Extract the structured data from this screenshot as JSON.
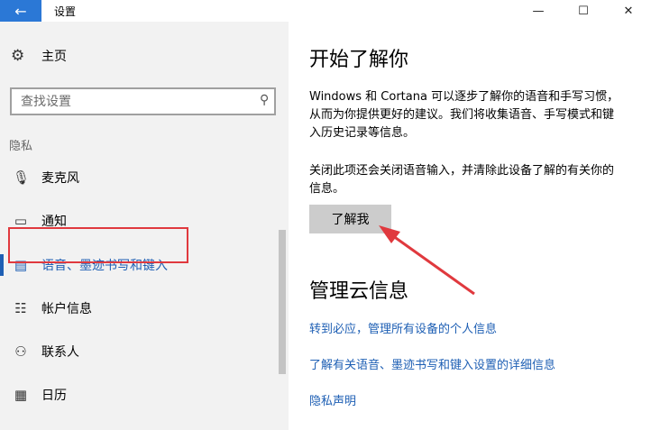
{
  "window": {
    "title": "设置",
    "back_icon": "←",
    "minimize_icon": "—",
    "maximize_icon": "☐",
    "close_icon": "✕"
  },
  "sidebar": {
    "home_label": "主页",
    "home_icon": "⚙",
    "search_placeholder": "查找设置",
    "search_icon": "⚲",
    "section_label": "隐私",
    "items": [
      {
        "label": "麦克风",
        "icon": "🎙"
      },
      {
        "label": "通知",
        "icon": "▭"
      },
      {
        "label": "语音、墨迹书写和键入",
        "icon": "▤",
        "active": true
      },
      {
        "label": "帐户信息",
        "icon": "☷"
      },
      {
        "label": "联系人",
        "icon": "⚇"
      },
      {
        "label": "日历",
        "icon": "▦"
      }
    ]
  },
  "main": {
    "heading": "开始了解你",
    "description": "Windows 和 Cortana 可以逐步了解你的语音和手写习惯，从而为你提供更好的建议。我们将收集语音、手写模式和键入历史记录等信息。",
    "note": "关闭此项还会关闭语音输入，并清除此设备了解的有关你的信息。",
    "button_label": "了解我",
    "cloud_heading": "管理云信息",
    "links": [
      "转到必应，管理所有设备的个人信息",
      "了解有关语音、墨迹书写和键入设置的详细信息",
      "隐私声明"
    ]
  },
  "annotation": {
    "highlight_color": "#e0393e",
    "arrow_color": "#e0393e"
  }
}
